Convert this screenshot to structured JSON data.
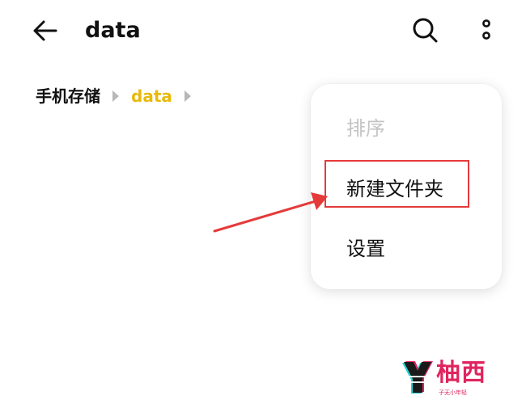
{
  "header": {
    "title": "data",
    "back_icon": "back-arrow-icon",
    "search_icon": "search-icon",
    "more_icon": "more-vertical-icon"
  },
  "breadcrumb": {
    "root": "手机存储",
    "current": "data",
    "current_color": "#e8b90c"
  },
  "menu": {
    "items": [
      {
        "label": "排序",
        "enabled": false
      },
      {
        "label": "新建文件夹",
        "enabled": true
      },
      {
        "label": "设置",
        "enabled": true
      }
    ]
  },
  "annotation": {
    "highlight_color": "#e53a3a",
    "target": "新建文件夹"
  },
  "watermark": {
    "logo": "柚西",
    "tagline": "子无小年轻"
  }
}
